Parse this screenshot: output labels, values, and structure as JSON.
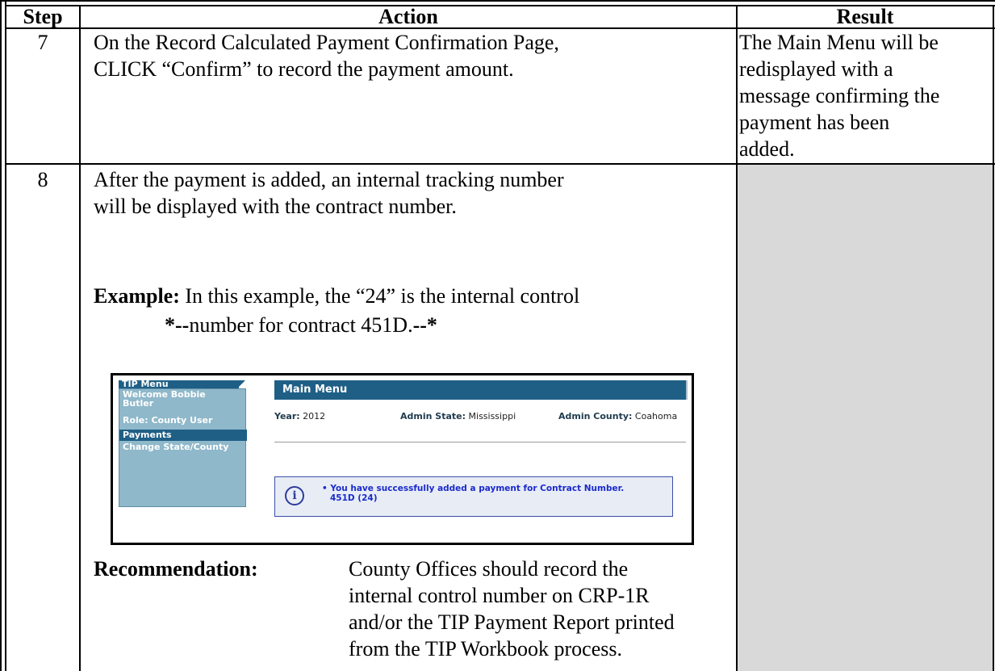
{
  "table": {
    "headers": {
      "step": "Step",
      "action": "Action",
      "result": "Result"
    },
    "rows": [
      {
        "step": "7",
        "action_lines": [
          "On the Record Calculated Payment Confirmation Page,",
          "CLICK “Confirm” to record the payment amount."
        ],
        "result_lines": [
          "The Main Menu will be",
          "redisplayed with a",
          "message confirming the",
          "payment has been",
          "added."
        ]
      },
      {
        "step": "8",
        "action_lines": [
          "After the payment is added, an internal tracking number",
          "will be displayed with the contract number."
        ],
        "example_label": "Example:",
        "example_text": " In this example, the “24” is the internal control",
        "example_line2_prefix": "*--",
        "example_line2_text": "number for contract 451D.",
        "example_line2_suffix": "--*",
        "recommendation_label": "Recommendation:",
        "recommendation_lines": [
          "County Offices should record the",
          "internal control number on CRP-1R",
          "and/or the TIP Payment Report printed",
          "from the TIP Workbook process."
        ]
      }
    ]
  },
  "screenshot": {
    "menu_title": "TIP Menu",
    "welcome_line1": "Welcome Bobbie",
    "welcome_line2": "Butler",
    "role": "Role: County User",
    "payments": "Payments",
    "change": "Change State/County",
    "main_title": "Main Menu",
    "year_label": "Year:",
    "year_value": "2012",
    "state_label": "Admin State:",
    "state_value": "Mississippi",
    "county_label": "Admin County:",
    "county_value": "Coahoma",
    "message_line1": "• You have successfully added a payment for Contract Number.",
    "message_line2": "451D (24)",
    "info_icon_glyph": "i"
  }
}
